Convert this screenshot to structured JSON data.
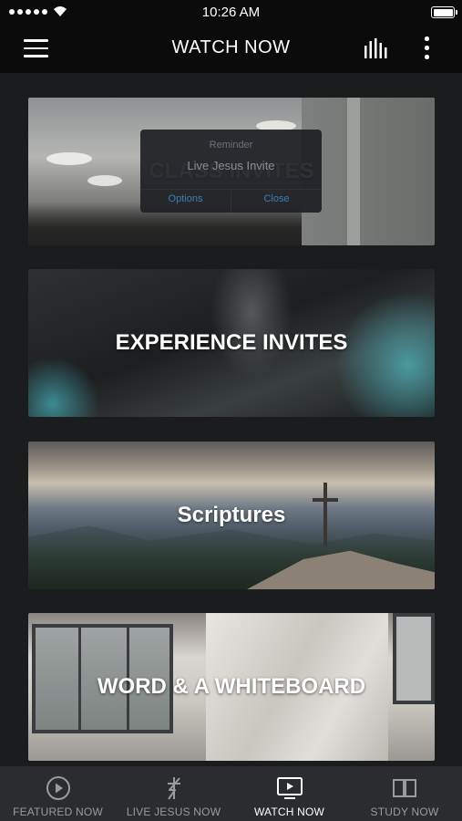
{
  "status_bar": {
    "time": "10:26 AM"
  },
  "header": {
    "title": "WATCH NOW"
  },
  "cards": [
    {
      "label": "CLASS INVITES"
    },
    {
      "label": "EXPERIENCE INVITES"
    },
    {
      "label": "Scriptures"
    },
    {
      "label": "WORD & A WHITEBOARD"
    }
  ],
  "popup": {
    "title": "Reminder",
    "message": "Live Jesus Invite",
    "options_label": "Options",
    "close_label": "Close"
  },
  "tabs": [
    {
      "label": "FEATURED NOW",
      "icon": "play-circle-icon",
      "active": false
    },
    {
      "label": "LIVE JESUS NOW",
      "icon": "lightning-cross-icon",
      "active": false
    },
    {
      "label": "WATCH NOW",
      "icon": "tv-play-icon",
      "active": true
    },
    {
      "label": "STUDY NOW",
      "icon": "book-icon",
      "active": false
    }
  ],
  "colors": {
    "background": "#1b1c1e",
    "nav": "#0b0b0c",
    "tabbar": "#2b2c2f",
    "popup_link": "#3d7fb5"
  }
}
